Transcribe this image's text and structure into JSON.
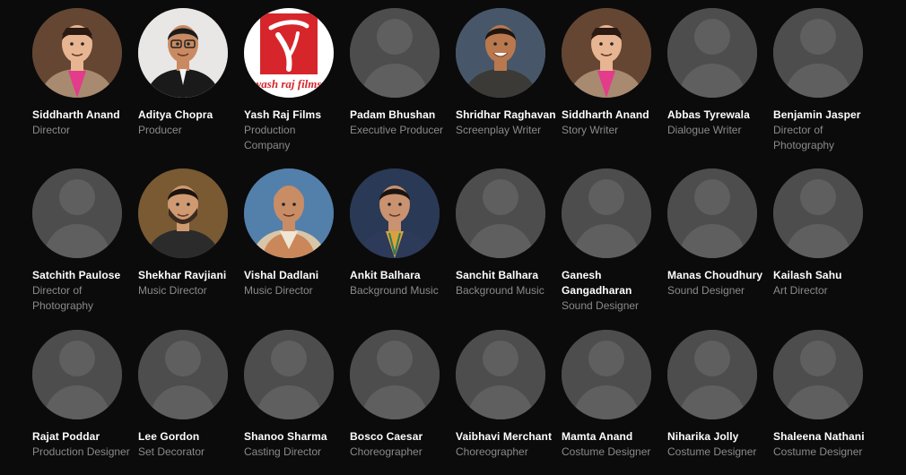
{
  "crew": [
    {
      "name": "Siddharth Anand",
      "role": "Director",
      "avatar": "photo-man-pink-shirt"
    },
    {
      "name": "Aditya Chopra",
      "role": "Producer",
      "avatar": "photo-man-glasses"
    },
    {
      "name": "Yash Raj Films",
      "role": "Production Company",
      "avatar": "logo-yash-raj-films",
      "logo_text": "yash raj films"
    },
    {
      "name": "Padam Bhushan",
      "role": "Executive Producer",
      "avatar": "placeholder-person-icon"
    },
    {
      "name": "Shridhar Raghavan",
      "role": "Screenplay Writer",
      "avatar": "photo-man-smiling"
    },
    {
      "name": "Siddharth Anand",
      "role": "Story Writer",
      "avatar": "photo-man-pink-shirt"
    },
    {
      "name": "Abbas Tyrewala",
      "role": "Dialogue Writer",
      "avatar": "placeholder-person-icon"
    },
    {
      "name": "Benjamin Jasper",
      "role": "Director of Photography",
      "avatar": "placeholder-person-icon"
    },
    {
      "name": "Satchith Paulose",
      "role": "Director of Photography",
      "avatar": "placeholder-person-icon"
    },
    {
      "name": "Shekhar Ravjiani",
      "role": "Music Director",
      "avatar": "photo-man-beard"
    },
    {
      "name": "Vishal Dadlani",
      "role": "Music Director",
      "avatar": "photo-man-bald"
    },
    {
      "name": "Ankit Balhara",
      "role": "Background Music",
      "avatar": "photo-man-scarf"
    },
    {
      "name": "Sanchit Balhara",
      "role": "Background Music",
      "avatar": "placeholder-person-icon"
    },
    {
      "name": "Ganesh Gangadharan",
      "role": "Sound Designer",
      "avatar": "placeholder-person-icon"
    },
    {
      "name": "Manas Choudhury",
      "role": "Sound Designer",
      "avatar": "placeholder-person-icon"
    },
    {
      "name": "Kailash Sahu",
      "role": "Art Director",
      "avatar": "placeholder-person-icon"
    },
    {
      "name": "Rajat Poddar",
      "role": "Production Designer",
      "avatar": "placeholder-person-icon"
    },
    {
      "name": "Lee Gordon",
      "role": "Set Decorator",
      "avatar": "placeholder-person-icon"
    },
    {
      "name": "Shanoo Sharma",
      "role": "Casting Director",
      "avatar": "placeholder-person-icon"
    },
    {
      "name": "Bosco Caesar",
      "role": "Choreographer",
      "avatar": "placeholder-person-icon"
    },
    {
      "name": "Vaibhavi Merchant",
      "role": "Choreographer",
      "avatar": "placeholder-person-icon"
    },
    {
      "name": "Mamta Anand",
      "role": "Costume Designer",
      "avatar": "placeholder-person-icon"
    },
    {
      "name": "Niharika Jolly",
      "role": "Costume Designer",
      "avatar": "placeholder-person-icon"
    },
    {
      "name": "Shaleena Nathani",
      "role": "Costume Designer",
      "avatar": "placeholder-person-icon"
    }
  ],
  "colors": {
    "background": "#0b0b0b",
    "name": "#ffffff",
    "role": "#8a8a8a",
    "placeholder_bg": "#4d4d4d",
    "placeholder_fg": "#6a6a6a"
  }
}
